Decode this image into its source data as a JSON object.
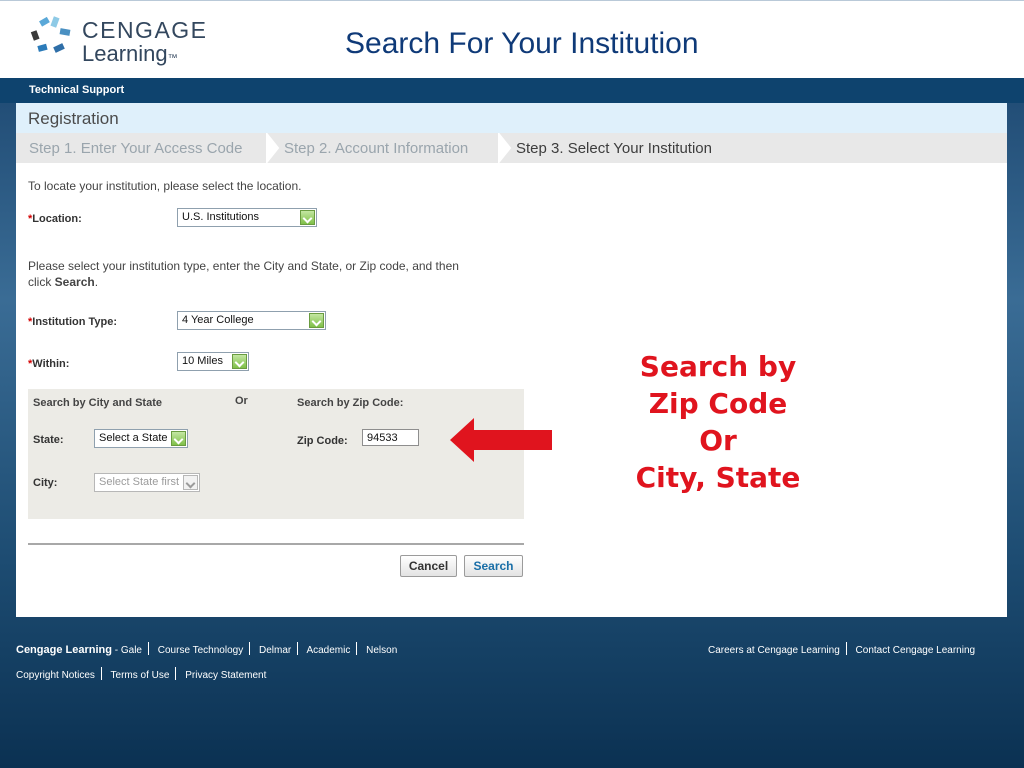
{
  "slide": {
    "title": "Search For Your Institution"
  },
  "logo": {
    "line1": "CENGAGE",
    "line2": "Learning",
    "tm": "™"
  },
  "topbar": {
    "link": "Technical Support"
  },
  "registration": {
    "title": "Registration",
    "steps": [
      {
        "label": "Step 1.  Enter Your Access Code",
        "active": false
      },
      {
        "label": "Step 2. Account Information",
        "active": false
      },
      {
        "label": "Step 3. Select Your Institution",
        "active": true
      }
    ]
  },
  "form": {
    "intro": "To locate your institution, please select the location.",
    "location": {
      "label": "Location:",
      "value": "U.S. Institutions"
    },
    "instructions_line1": "Please select your institution type, enter the City and State, or Zip code, and then",
    "instructions_line2_pre": "click ",
    "instructions_line2_bold": "Search",
    "instructions_line2_post": ".",
    "institution_type": {
      "label": "Institution Type:",
      "value": "4 Year College"
    },
    "within": {
      "label": "Within:",
      "value": "10 Miles"
    },
    "required_mark": "*",
    "search_box": {
      "city_state_heading": "Search by City and State",
      "or": "Or",
      "zip_heading": "Search by Zip Code:",
      "state_label": "State:",
      "state_value": "Select a State",
      "city_label": "City:",
      "city_value": "Select State first",
      "zip_label": "Zip Code:",
      "zip_value": "94533"
    },
    "buttons": {
      "cancel": "Cancel",
      "search": "Search"
    }
  },
  "callout": {
    "line1": "Search by",
    "line2": "Zip Code",
    "line3": "Or",
    "line4": "City, State"
  },
  "footer": {
    "brand": "Cengage Learning",
    "brand_dash": " - ",
    "links_left": [
      "Gale",
      "Course Technology",
      "Delmar",
      "Academic",
      "Nelson"
    ],
    "links_right": [
      "Careers at Cengage Learning",
      "Contact Cengage Learning"
    ],
    "links_bottom": [
      "Copyright Notices",
      "Terms of Use",
      "Privacy Statement"
    ]
  },
  "colors": {
    "accent_blue": "#0e436e",
    "callout_red": "#e0141e",
    "select_green": "#7fbf48"
  }
}
